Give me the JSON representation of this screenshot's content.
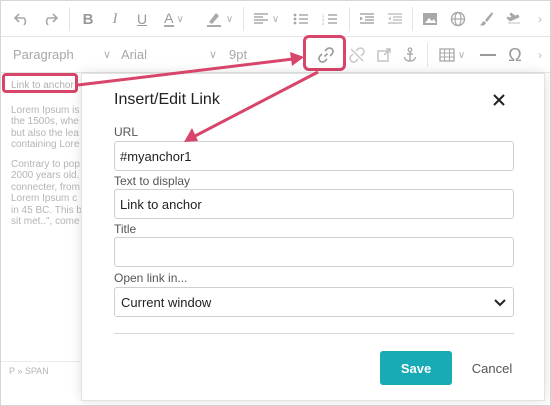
{
  "toolbar": {
    "paragraph_label": "Paragraph",
    "font_label": "Arial",
    "size_label": "9pt"
  },
  "content": {
    "anchor_text": "Link to anchor",
    "para1": "Lorem Ipsum is the 1500s, whe but also the lea containing Lore",
    "para2": "Contrary to pop 2000 years old. connecter, from Lorem Ipsum c in 45 BC. This b sit met..\", come"
  },
  "statusbar": {
    "path": "P » SPAN"
  },
  "dialog": {
    "title": "Insert/Edit Link",
    "url_label": "URL",
    "url_value": "#myanchor1",
    "text_label": "Text to display",
    "text_value": "Link to anchor",
    "title_label": "Title",
    "title_value": "",
    "open_label": "Open link in...",
    "open_value": "Current window",
    "save_label": "Save",
    "cancel_label": "Cancel"
  },
  "colors": {
    "accent": "#18aab5",
    "highlight": "#d8456a"
  }
}
